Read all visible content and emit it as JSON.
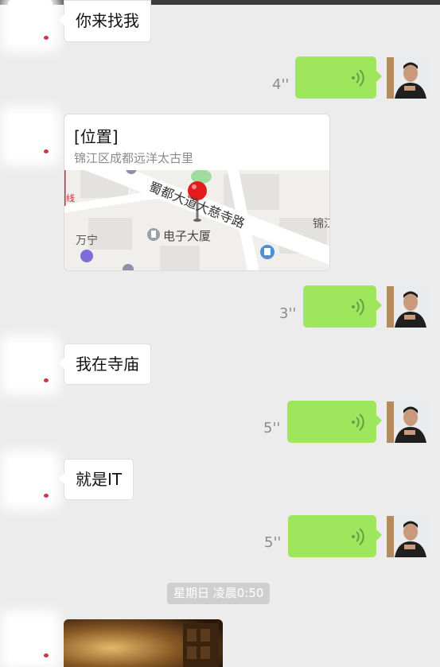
{
  "messages": {
    "m1_text": "你来找我",
    "voice1_len": "4''",
    "location": {
      "title": "[位置]",
      "address": "锦江区成都远洋太古里",
      "map_labels": {
        "road": "蜀都大道大慈寺路",
        "building": "电子大厦",
        "area1": "万宁",
        "area2": "锦江",
        "line": "线"
      }
    },
    "voice2_len": "3''",
    "m2_text": "我在寺庙",
    "voice3_len": "5''",
    "m3_text": "就是IT",
    "voice4_len": "5''",
    "timestamp": "星期日 凌晨0:50"
  },
  "colors": {
    "background": "#ececec",
    "voice_bubble": "#9ee65c",
    "text_bubble": "#ffffff",
    "map_pin": "#e41b1b"
  },
  "icons": {
    "voice": "voice-wave-icon",
    "pin": "map-pin-icon"
  }
}
